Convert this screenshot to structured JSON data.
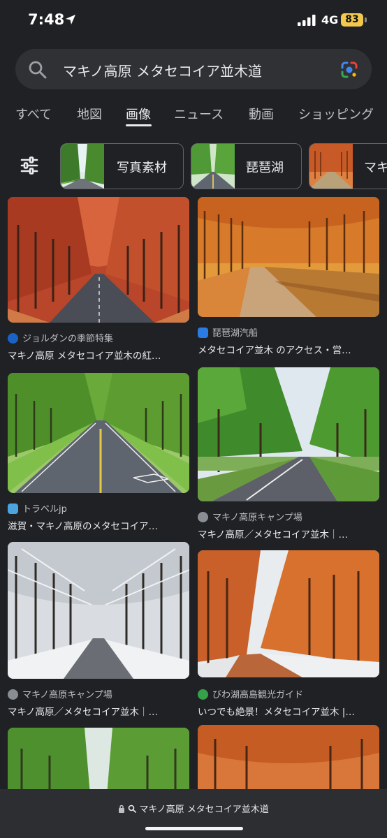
{
  "status": {
    "time": "7:48",
    "network": "4G",
    "battery": "83"
  },
  "search": {
    "query": "マキノ高原 メタセコイア並木道"
  },
  "tabs": [
    {
      "label": "すべて"
    },
    {
      "label": "地図"
    },
    {
      "label": "画像",
      "active": true
    },
    {
      "label": "ニュース"
    },
    {
      "label": "動画"
    },
    {
      "label": "ショッピング"
    }
  ],
  "chips": [
    {
      "label": "写真素材"
    },
    {
      "label": "琵琶湖"
    },
    {
      "label": "マキ"
    }
  ],
  "results": [
    {
      "source": "ジョルダンの季節特集",
      "caption": "マキノ高原 メタセコイア並木の紅…",
      "palette": "autumn"
    },
    {
      "source": "琵琶湖汽船",
      "caption": "メタセコイア並木 のアクセス・営…",
      "palette": "autumn-gold"
    },
    {
      "source": "トラベルjp",
      "caption": "滋賀・マキノ高原のメタセコイア…",
      "palette": "green"
    },
    {
      "source": "マキノ高原キャンプ場",
      "caption": "マキノ高原／メタセコイア並木｜…",
      "palette": "green-bright"
    },
    {
      "source": "マキノ高原キャンプ場",
      "caption": "マキノ高原／メタセコイア並木｜…",
      "palette": "snow"
    },
    {
      "source": "びわ湖高島観光ガイド",
      "caption": "いつでも絶景！メタセコイア並木 |…",
      "palette": "autumn"
    },
    {
      "source": "",
      "caption": "",
      "palette": "green"
    },
    {
      "source": "",
      "caption": "",
      "palette": "autumn"
    }
  ],
  "browser": {
    "url": "マキノ高原 メタセコイア並木道"
  }
}
